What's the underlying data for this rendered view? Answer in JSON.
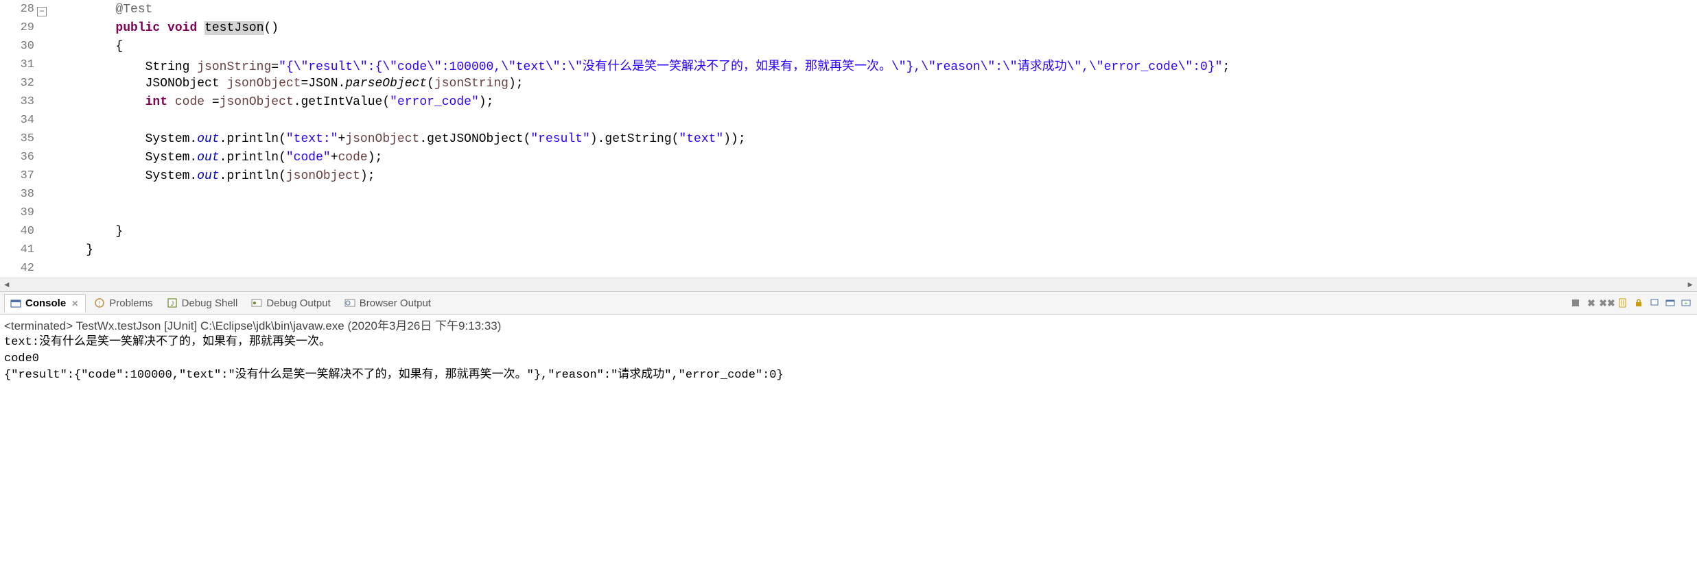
{
  "editor": {
    "lines": [
      {
        "num": "28",
        "fold": true,
        "indent": "        ",
        "tokens": [
          {
            "cls": "tk-annotation",
            "t": "@Test"
          }
        ]
      },
      {
        "num": "29",
        "indent": "        ",
        "tokens": [
          {
            "cls": "tk-keyword",
            "t": "public"
          },
          {
            "cls": "tk-plain",
            "t": " "
          },
          {
            "cls": "tk-keyword",
            "t": "void"
          },
          {
            "cls": "tk-plain",
            "t": " "
          },
          {
            "cls": "tk-method-decl tk-hl",
            "t": "testJson"
          },
          {
            "cls": "tk-plain",
            "t": "()"
          }
        ]
      },
      {
        "num": "30",
        "indent": "        ",
        "tokens": [
          {
            "cls": "tk-plain",
            "t": "{"
          }
        ]
      },
      {
        "num": "31",
        "indent": "            ",
        "tokens": [
          {
            "cls": "tk-plain",
            "t": "String "
          },
          {
            "cls": "tk-var",
            "t": "jsonString"
          },
          {
            "cls": "tk-plain",
            "t": "="
          },
          {
            "cls": "tk-string",
            "t": "\"{\\\"result\\\":{\\\"code\\\":100000,\\\"text\\\":\\\"没有什么是笑一笑解决不了的，如果有，那就再笑一次。\\\"},\\\"reason\\\":\\\"请求成功\\\",\\\"error_code\\\":0}\""
          },
          {
            "cls": "tk-plain",
            "t": ";"
          }
        ]
      },
      {
        "num": "32",
        "indent": "            ",
        "tokens": [
          {
            "cls": "tk-plain",
            "t": "JSONObject "
          },
          {
            "cls": "tk-var",
            "t": "jsonObject"
          },
          {
            "cls": "tk-plain",
            "t": "=JSON."
          },
          {
            "cls": "tk-static-call",
            "t": "parseObject"
          },
          {
            "cls": "tk-plain",
            "t": "("
          },
          {
            "cls": "tk-var",
            "t": "jsonString"
          },
          {
            "cls": "tk-plain",
            "t": ");"
          }
        ]
      },
      {
        "num": "33",
        "indent": "            ",
        "tokens": [
          {
            "cls": "tk-keyword",
            "t": "int"
          },
          {
            "cls": "tk-plain",
            "t": " "
          },
          {
            "cls": "tk-var",
            "t": "code"
          },
          {
            "cls": "tk-plain",
            "t": " ="
          },
          {
            "cls": "tk-var",
            "t": "jsonObject"
          },
          {
            "cls": "tk-plain",
            "t": ".getIntValue("
          },
          {
            "cls": "tk-string",
            "t": "\"error_code\""
          },
          {
            "cls": "tk-plain",
            "t": ");"
          }
        ]
      },
      {
        "num": "34",
        "indent": "",
        "tokens": []
      },
      {
        "num": "35",
        "indent": "            ",
        "tokens": [
          {
            "cls": "tk-plain",
            "t": "System."
          },
          {
            "cls": "tk-static-field",
            "t": "out"
          },
          {
            "cls": "tk-plain",
            "t": ".println("
          },
          {
            "cls": "tk-string",
            "t": "\"text:\""
          },
          {
            "cls": "tk-plain",
            "t": "+"
          },
          {
            "cls": "tk-var",
            "t": "jsonObject"
          },
          {
            "cls": "tk-plain",
            "t": ".getJSONObject("
          },
          {
            "cls": "tk-string",
            "t": "\"result\""
          },
          {
            "cls": "tk-plain",
            "t": ").getString("
          },
          {
            "cls": "tk-string",
            "t": "\"text\""
          },
          {
            "cls": "tk-plain",
            "t": "));"
          }
        ]
      },
      {
        "num": "36",
        "indent": "            ",
        "tokens": [
          {
            "cls": "tk-plain",
            "t": "System."
          },
          {
            "cls": "tk-static-field",
            "t": "out"
          },
          {
            "cls": "tk-plain",
            "t": ".println("
          },
          {
            "cls": "tk-string",
            "t": "\"code\""
          },
          {
            "cls": "tk-plain",
            "t": "+"
          },
          {
            "cls": "tk-var",
            "t": "code"
          },
          {
            "cls": "tk-plain",
            "t": ");"
          }
        ]
      },
      {
        "num": "37",
        "indent": "            ",
        "tokens": [
          {
            "cls": "tk-plain",
            "t": "System."
          },
          {
            "cls": "tk-static-field",
            "t": "out"
          },
          {
            "cls": "tk-plain",
            "t": ".println("
          },
          {
            "cls": "tk-var",
            "t": "jsonObject"
          },
          {
            "cls": "tk-plain",
            "t": ");"
          }
        ]
      },
      {
        "num": "38",
        "indent": "",
        "tokens": []
      },
      {
        "num": "39",
        "indent": "",
        "tokens": []
      },
      {
        "num": "40",
        "indent": "        ",
        "tokens": [
          {
            "cls": "tk-plain",
            "t": "}"
          }
        ]
      },
      {
        "num": "41",
        "indent": "    ",
        "tokens": [
          {
            "cls": "tk-plain",
            "t": "}"
          }
        ]
      },
      {
        "num": "42",
        "indent": "",
        "tokens": []
      }
    ]
  },
  "tabs": {
    "console": "Console",
    "problems": "Problems",
    "debug_shell": "Debug Shell",
    "debug_output": "Debug Output",
    "browser_output": "Browser Output"
  },
  "console": {
    "header": "<terminated> TestWx.testJson [JUnit] C:\\Eclipse\\jdk\\bin\\javaw.exe (2020年3月26日 下午9:13:33)",
    "lines": [
      "text:没有什么是笑一笑解决不了的，如果有，那就再笑一次。",
      "code0",
      "{\"result\":{\"code\":100000,\"text\":\"没有什么是笑一笑解决不了的，如果有，那就再笑一次。\"},\"reason\":\"请求成功\",\"error_code\":0}"
    ]
  }
}
